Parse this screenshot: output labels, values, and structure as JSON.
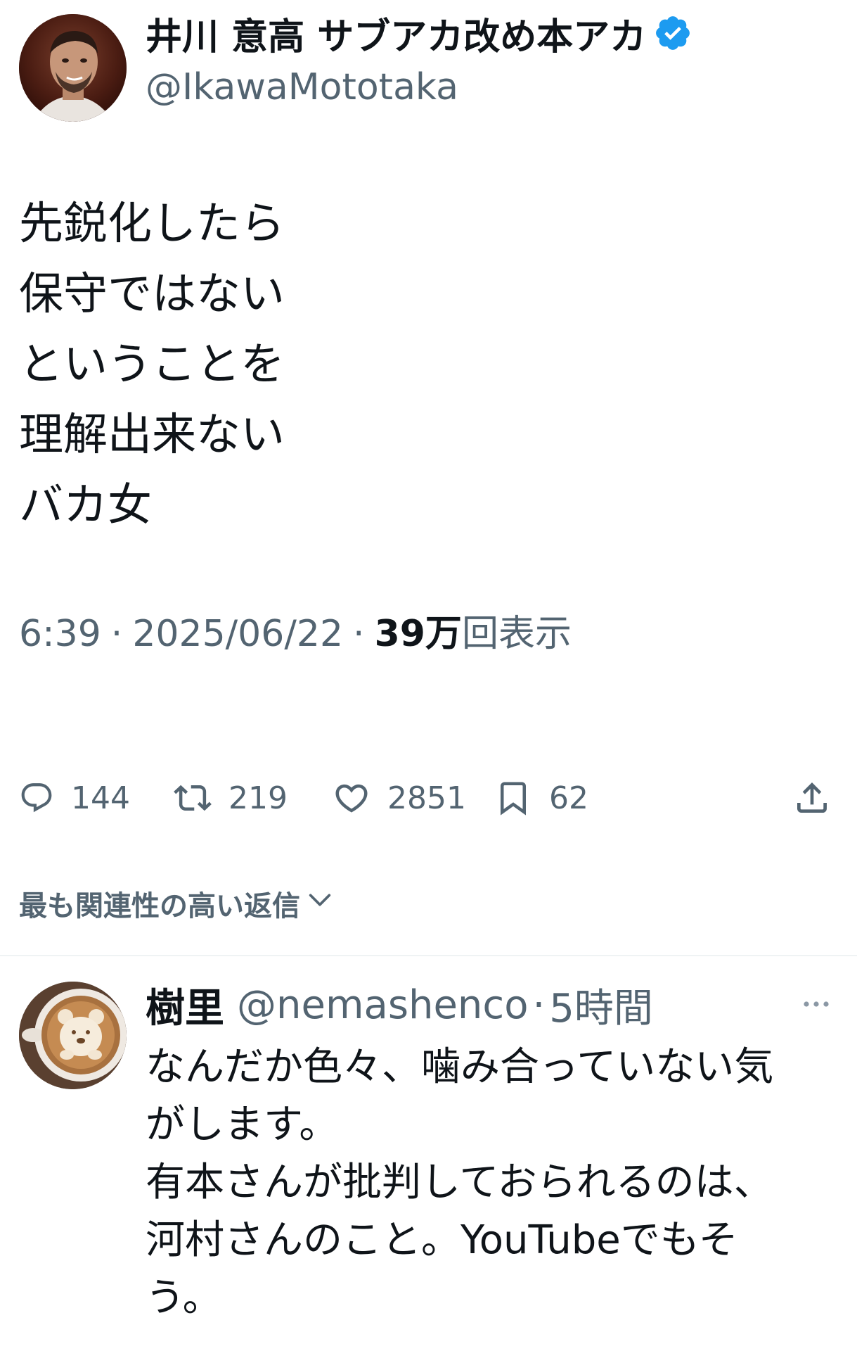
{
  "tweet": {
    "author": {
      "display_name": "井川 意高 サブアカ改め本アカ",
      "handle": "@IkawaMototaka",
      "verified": true
    },
    "text_lines": [
      "先鋭化したら",
      "保守ではない",
      "ということを",
      "理解出来ない",
      "バカ女"
    ],
    "meta": {
      "time": "6:39",
      "separator": "·",
      "date": "2025/06/22",
      "views_count": "39万",
      "views_label": "回表示"
    },
    "actions": {
      "replies": "144",
      "retweets": "219",
      "likes": "2851",
      "bookmarks": "62"
    }
  },
  "replies_sort": {
    "label": "最も関連性の高い返信"
  },
  "reply": {
    "display_name": "樹里",
    "handle": "@nemashenco",
    "separator": "·",
    "time": "5時間",
    "text_lines": [
      "なんだか色々、噛み合っていない気",
      "がします。",
      "有本さんが批判しておられるのは、",
      "河村さんのこと。YouTubeでもそ",
      "う。"
    ]
  },
  "colors": {
    "text_primary": "#0f1419",
    "text_secondary": "#536471",
    "verified_blue": "#1d9bf0",
    "divider": "#eff3f4"
  },
  "icons": {
    "verified": "verified-badge-icon",
    "reply": "speech-bubble-icon",
    "retweet": "retweet-icon",
    "like": "heart-icon",
    "bookmark": "bookmark-icon",
    "share": "share-upload-icon",
    "sort": "chevron-down-icon",
    "more": "more-horizontal-icon"
  }
}
